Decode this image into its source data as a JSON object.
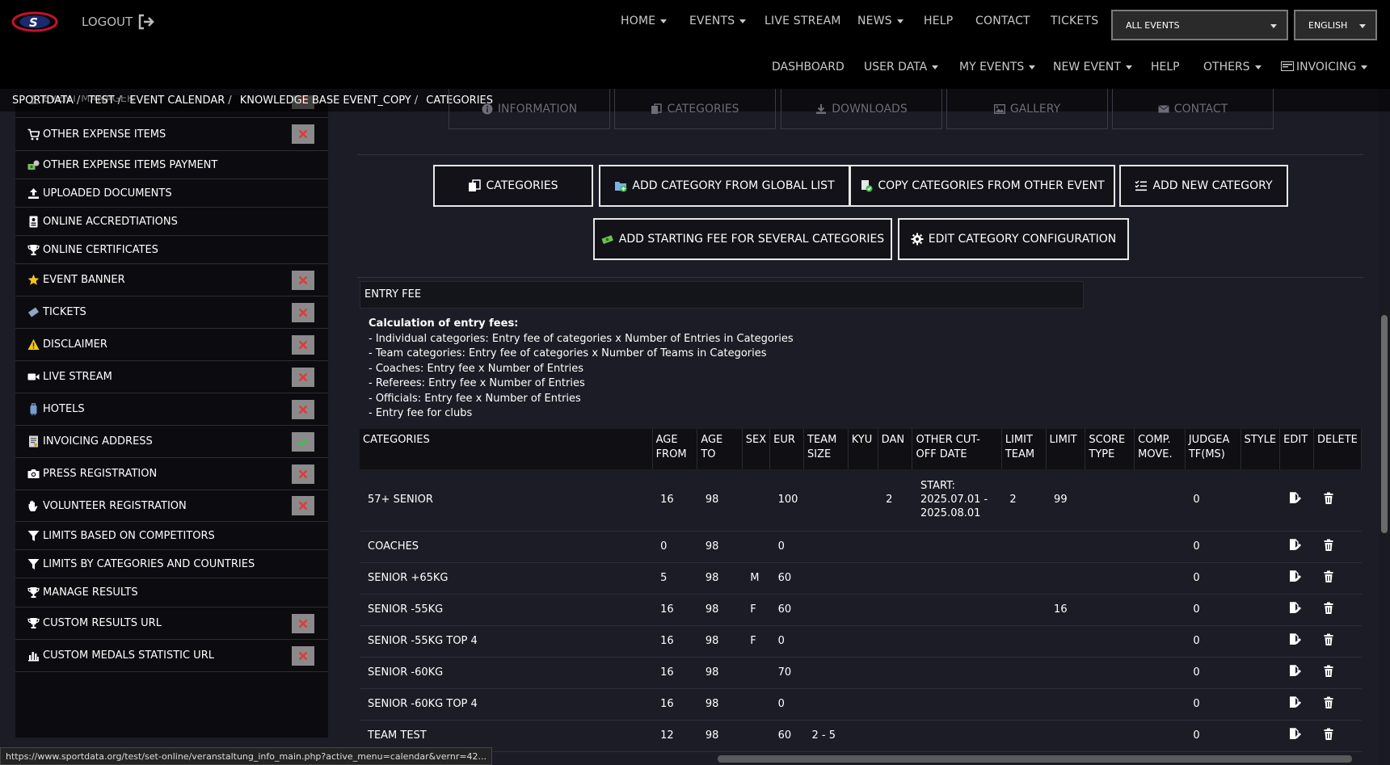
{
  "header": {
    "logout_label": "LOGOUT",
    "nav": [
      {
        "label": "HOME",
        "dropdown": true
      },
      {
        "label": "EVENTS",
        "dropdown": true
      },
      {
        "label": "LIVE STREAM",
        "dropdown": false
      },
      {
        "label": "NEWS",
        "dropdown": true
      },
      {
        "label": "HELP",
        "dropdown": false
      },
      {
        "label": "CONTACT",
        "dropdown": false
      },
      {
        "label": "TICKETS",
        "dropdown": false
      }
    ],
    "event_select": "ALL EVENTS",
    "language_select": "ENGLISH"
  },
  "subnav": {
    "items": [
      {
        "label": "DASHBOARD"
      },
      {
        "label": "USER DATA"
      },
      {
        "label": "MY EVENTS"
      },
      {
        "label": "NEW EVENT"
      },
      {
        "label": "HELP"
      },
      {
        "label": "OTHERS"
      },
      {
        "label": "INVOICING"
      }
    ]
  },
  "breadcrumb": [
    "SPORTDATA",
    "TEST",
    "EVENT CALENDAR",
    "KNOWLEDGE BASE EVENT_COPY",
    "CATEGORIES"
  ],
  "event_tabs": [
    "INFORMATION",
    "CATEGORIES",
    "DOWNLOADS",
    "GALLERY",
    "CONTACT"
  ],
  "sidebar": {
    "items": [
      {
        "label": "EVENT MANAGER",
        "icon": "user-icon",
        "status": "x"
      },
      {
        "label": "OTHER EXPENSE ITEMS",
        "icon": "cart-icon",
        "status": "x"
      },
      {
        "label": "OTHER EXPENSE ITEMS PAYMENT",
        "icon": "money-icon",
        "status": ""
      },
      {
        "label": "UPLOADED DOCUMENTS",
        "icon": "upload-icon",
        "status": ""
      },
      {
        "label": "ONLINE ACCREDTIATIONS",
        "icon": "id-card-icon",
        "status": ""
      },
      {
        "label": "ONLINE CERTIFICATES",
        "icon": "trophy-icon",
        "status": ""
      },
      {
        "label": "EVENT BANNER",
        "icon": "star-icon",
        "status": "x"
      },
      {
        "label": "TICKETS",
        "icon": "ticket-icon",
        "status": "x"
      },
      {
        "label": "DISCLAIMER",
        "icon": "warning-icon",
        "status": "x"
      },
      {
        "label": "LIVE STREAM",
        "icon": "video-icon",
        "status": "x"
      },
      {
        "label": "HOTELS",
        "icon": "luggage-icon",
        "status": "x"
      },
      {
        "label": "INVOICING ADDRESS",
        "icon": "invoice-icon",
        "status": "ok"
      },
      {
        "label": "PRESS REGISTRATION",
        "icon": "camera-icon",
        "status": "x"
      },
      {
        "label": "VOLUNTEER REGISTRATION",
        "icon": "hand-icon",
        "status": "x"
      },
      {
        "label": "LIMITS BASED ON COMPETITORS",
        "icon": "filter-icon",
        "status": ""
      },
      {
        "label": "LIMITS BY CATEGORIES AND COUNTRIES",
        "icon": "filter-icon",
        "status": ""
      },
      {
        "label": "MANAGE RESULTS",
        "icon": "trophy-icon",
        "status": ""
      },
      {
        "label": "CUSTOM RESULTS URL",
        "icon": "trophy-icon",
        "status": "x"
      },
      {
        "label": "CUSTOM MEDALS STATISTIC URL",
        "icon": "bar-chart-icon",
        "status": "x"
      }
    ]
  },
  "actions": {
    "categories": "CATEGORIES",
    "add_global": "ADD CATEGORY FROM GLOBAL LIST",
    "copy_other": "COPY CATEGORIES FROM OTHER EVENT",
    "add_new": "ADD NEW CATEGORY",
    "add_fee": "ADD STARTING FEE FOR SEVERAL CATEGORIES",
    "edit_config": "EDIT CATEGORY CONFIGURATION"
  },
  "entry_fee": {
    "heading": "ENTRY FEE",
    "calc_title": "Calculation of entry fees:",
    "lines": [
      "- Individual categories: Entry fee of categories x Number of Entries in Categories",
      "- Team categories: Entry fee of categories x Number of Teams in Categories",
      "- Coaches: Entry fee x Number of Entries",
      "- Referees: Entry fee x Number of Entries",
      "- Officials: Entry fee x Number of Entries",
      "- Entry fee for clubs"
    ]
  },
  "table": {
    "headers": [
      "CATEGORIES",
      "AGE FROM",
      "AGE TO",
      "SEX",
      "EUR",
      "TEAM SIZE",
      "KYU",
      "DAN",
      "OTHER CUT-OFF DATE",
      "LIMIT TEAM",
      "LIMIT",
      "SCORE TYPE",
      "COMP. MOVE.",
      "JUDGEA TF(MS)",
      "STYLE",
      "EDIT",
      "DELETE"
    ],
    "rows": [
      {
        "name": "57+ SENIOR",
        "age_from": "16",
        "age_to": "98",
        "sex": "",
        "eur": "100",
        "team_size": "",
        "kyu": "",
        "dan": "2",
        "cutoff": "START: 2025.07.01 - 2025.08.01",
        "limit_team": "2",
        "limit": "99",
        "score": "",
        "comp": "",
        "judge": "0",
        "style": ""
      },
      {
        "name": "COACHES",
        "age_from": "0",
        "age_to": "98",
        "sex": "",
        "eur": "0",
        "team_size": "",
        "kyu": "",
        "dan": "",
        "cutoff": "",
        "limit_team": "",
        "limit": "",
        "score": "",
        "comp": "",
        "judge": "0",
        "style": ""
      },
      {
        "name": "SENIOR +65KG",
        "age_from": "5",
        "age_to": "98",
        "sex": "M",
        "eur": "60",
        "team_size": "",
        "kyu": "",
        "dan": "",
        "cutoff": "",
        "limit_team": "",
        "limit": "",
        "score": "",
        "comp": "",
        "judge": "0",
        "style": ""
      },
      {
        "name": "SENIOR -55KG",
        "age_from": "16",
        "age_to": "98",
        "sex": "F",
        "eur": "60",
        "team_size": "",
        "kyu": "",
        "dan": "",
        "cutoff": "",
        "limit_team": "",
        "limit": "16",
        "score": "",
        "comp": "",
        "judge": "0",
        "style": ""
      },
      {
        "name": "SENIOR -55KG TOP 4",
        "age_from": "16",
        "age_to": "98",
        "sex": "F",
        "eur": "0",
        "team_size": "",
        "kyu": "",
        "dan": "",
        "cutoff": "",
        "limit_team": "",
        "limit": "",
        "score": "",
        "comp": "",
        "judge": "0",
        "style": ""
      },
      {
        "name": "SENIOR -60KG",
        "age_from": "16",
        "age_to": "98",
        "sex": "",
        "eur": "70",
        "team_size": "",
        "kyu": "",
        "dan": "",
        "cutoff": "",
        "limit_team": "",
        "limit": "",
        "score": "",
        "comp": "",
        "judge": "0",
        "style": ""
      },
      {
        "name": "SENIOR -60KG TOP 4",
        "age_from": "16",
        "age_to": "98",
        "sex": "",
        "eur": "0",
        "team_size": "",
        "kyu": "",
        "dan": "",
        "cutoff": "",
        "limit_team": "",
        "limit": "",
        "score": "",
        "comp": "",
        "judge": "0",
        "style": ""
      },
      {
        "name": "TEAM TEST",
        "age_from": "12",
        "age_to": "98",
        "sex": "",
        "eur": "60",
        "team_size": "2 - 5",
        "kyu": "",
        "dan": "",
        "cutoff": "",
        "limit_team": "",
        "limit": "",
        "score": "",
        "comp": "",
        "judge": "0",
        "style": ""
      }
    ]
  },
  "status_url": "https://www.sportdata.org/test/set-online/veranstaltung_info_main.php?active_menu=calendar&vernr=42...",
  "colors": {
    "bg": "#1c1c26",
    "topbar": "#000000",
    "sidebar": "#0c0c10",
    "x_button": "#8a8a8a",
    "x_mark": "#e03a3a",
    "ok_mark": "#3cc24a"
  }
}
